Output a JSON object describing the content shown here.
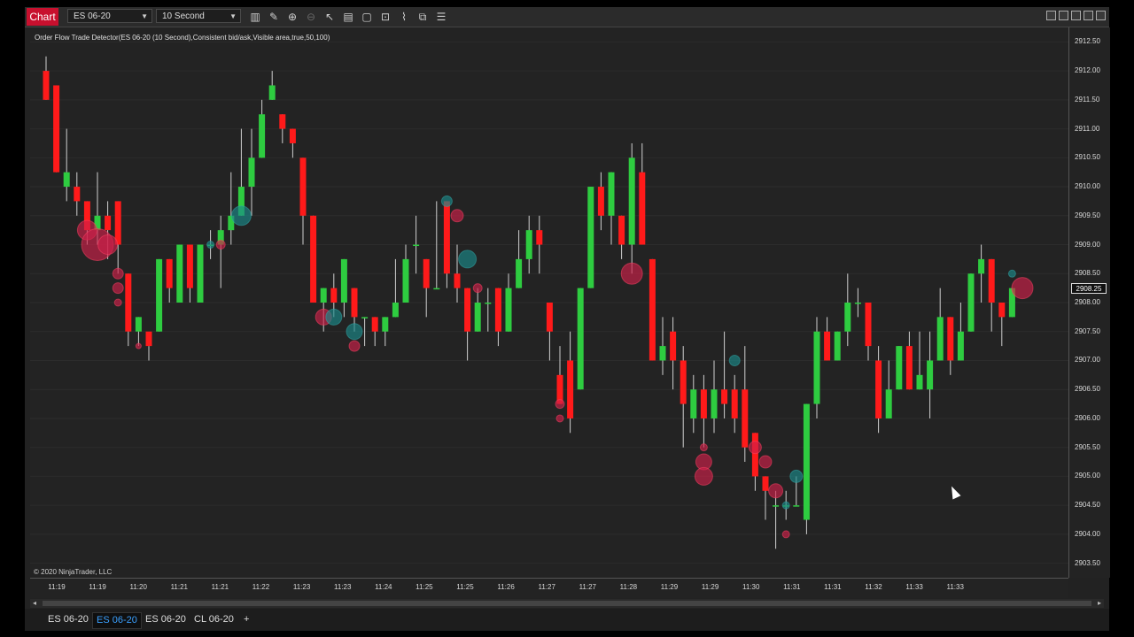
{
  "toolbar": {
    "chart_label": "Chart",
    "instrument": "ES 06-20",
    "interval": "10 Second",
    "icons": [
      "bars-icon",
      "draw-icon",
      "zoom-in-icon",
      "zoom-out-icon",
      "pointer-icon",
      "properties-icon",
      "data-box-icon",
      "snapshot-icon",
      "strategies-icon",
      "indicators-icon",
      "list-icon"
    ]
  },
  "indicator_label": "Order Flow Trade Detector(ES 06-20 (10 Second),Consistent bid/ask,Visible area,true,50,100)",
  "copyright": "© 2020 NinjaTrader, LLC",
  "price_axis": [
    "2912.50",
    "2912.00",
    "2911.50",
    "2911.00",
    "2910.50",
    "2910.00",
    "2909.50",
    "2909.00",
    "2908.50",
    "2908.00",
    "2907.50",
    "2907.00",
    "2906.50",
    "2906.00",
    "2905.50",
    "2905.00",
    "2904.50",
    "2904.00",
    "2903.50"
  ],
  "current_price": "2908.25",
  "time_axis": [
    "11:19",
    "11:19",
    "11:20",
    "11:21",
    "11:21",
    "11:22",
    "11:23",
    "11:23",
    "11:24",
    "11:25",
    "11:25",
    "11:26",
    "11:27",
    "11:27",
    "11:28",
    "11:29",
    "11:29",
    "11:30",
    "11:31",
    "11:31",
    "11:32",
    "11:33",
    "11:33"
  ],
  "tabs": [
    "ES 06-20",
    "ES 06-20",
    "ES 06-20",
    "CL 06-20"
  ],
  "add_tab": "+",
  "colors": {
    "up": "#2ecc40",
    "down": "#ff1a1a",
    "bubble_sell": "#d0204a",
    "bubble_buy": "#1a8a8a",
    "background": "#232323"
  },
  "chart_data": {
    "type": "candlestick",
    "y_range": [
      2903.25,
      2912.75
    ],
    "candles": [
      [
        2912.0,
        2911.5,
        2912.25,
        2911.5
      ],
      [
        2911.75,
        2910.25,
        2911.75,
        2910.25
      ],
      [
        2910.0,
        2910.25,
        2911.0,
        2909.75
      ],
      [
        2910.0,
        2909.75,
        2910.25,
        2909.5
      ],
      [
        2909.75,
        2909.25,
        2909.75,
        2909.0
      ],
      [
        2909.25,
        2909.5,
        2910.25,
        2909.0
      ],
      [
        2909.5,
        2909.25,
        2909.75,
        2908.75
      ],
      [
        2909.75,
        2909.0,
        2909.75,
        2908.5
      ],
      [
        2908.5,
        2907.5,
        2908.5,
        2907.25
      ],
      [
        2907.5,
        2907.75,
        2907.75,
        2907.25
      ],
      [
        2907.5,
        2907.25,
        2907.25,
        2907.0
      ],
      [
        2907.5,
        2908.75,
        2908.75,
        2907.5
      ],
      [
        2908.75,
        2908.25,
        2908.75,
        2908.0
      ],
      [
        2908.0,
        2909.0,
        2909.0,
        2908.0
      ],
      [
        2909.0,
        2908.25,
        2909.0,
        2908.0
      ],
      [
        2908.0,
        2909.0,
        2909.0,
        2908.0
      ],
      [
        2909.0,
        2909.0,
        2909.25,
        2908.75
      ],
      [
        2909.0,
        2909.25,
        2909.5,
        2908.25
      ],
      [
        2909.25,
        2909.5,
        2910.25,
        2909.0
      ],
      [
        2909.5,
        2910.0,
        2911.0,
        2909.5
      ],
      [
        2910.0,
        2910.5,
        2911.0,
        2909.5
      ],
      [
        2910.5,
        2911.25,
        2911.5,
        2910.5
      ],
      [
        2911.5,
        2911.75,
        2912.0,
        2911.5
      ],
      [
        2911.25,
        2911.0,
        2911.25,
        2910.75
      ],
      [
        2911.0,
        2910.75,
        2911.0,
        2910.5
      ],
      [
        2910.5,
        2909.5,
        2910.5,
        2909.0
      ],
      [
        2909.5,
        2908.0,
        2909.5,
        2908.0
      ],
      [
        2908.0,
        2908.25,
        2908.25,
        2907.5
      ],
      [
        2908.25,
        2908.0,
        2908.5,
        2907.75
      ],
      [
        2908.0,
        2908.75,
        2908.75,
        2907.75
      ],
      [
        2908.25,
        2907.75,
        2908.25,
        2907.5
      ],
      [
        2907.75,
        2907.75,
        2907.75,
        2907.25
      ],
      [
        2907.75,
        2907.5,
        2907.75,
        2907.25
      ],
      [
        2907.5,
        2907.75,
        2907.75,
        2907.25
      ],
      [
        2907.75,
        2908.0,
        2908.75,
        2907.75
      ],
      [
        2908.0,
        2908.75,
        2909.0,
        2908.0
      ],
      [
        2909.0,
        2909.0,
        2909.5,
        2908.5
      ],
      [
        2908.75,
        2908.25,
        2908.75,
        2907.75
      ],
      [
        2908.25,
        2908.25,
        2909.75,
        2908.25
      ],
      [
        2909.75,
        2908.5,
        2909.75,
        2908.25
      ],
      [
        2908.5,
        2908.25,
        2909.0,
        2908.0
      ],
      [
        2908.25,
        2907.5,
        2908.25,
        2907.0
      ],
      [
        2907.5,
        2908.0,
        2908.25,
        2907.5
      ],
      [
        2908.0,
        2908.0,
        2908.25,
        2907.5
      ],
      [
        2908.25,
        2907.5,
        2908.25,
        2907.25
      ],
      [
        2907.5,
        2908.25,
        2908.5,
        2907.5
      ],
      [
        2908.25,
        2908.75,
        2909.25,
        2908.25
      ],
      [
        2908.75,
        2909.25,
        2909.5,
        2908.5
      ],
      [
        2909.25,
        2909.0,
        2909.5,
        2908.5
      ],
      [
        2908.0,
        2907.5,
        2908.0,
        2907.0
      ],
      [
        2906.75,
        2906.25,
        2907.25,
        2906.25
      ],
      [
        2907.0,
        2906.0,
        2907.5,
        2905.75
      ],
      [
        2906.5,
        2908.25,
        2908.25,
        2906.5
      ],
      [
        2908.25,
        2910.0,
        2910.0,
        2908.25
      ],
      [
        2910.0,
        2909.5,
        2910.25,
        2909.25
      ],
      [
        2909.5,
        2910.25,
        2910.25,
        2909.0
      ],
      [
        2909.5,
        2909.0,
        2909.5,
        2908.75
      ],
      [
        2909.0,
        2910.5,
        2910.75,
        2908.5
      ],
      [
        2910.25,
        2909.0,
        2910.75,
        2909.0
      ],
      [
        2908.75,
        2907.0,
        2908.75,
        2907.0
      ],
      [
        2907.0,
        2907.25,
        2907.75,
        2906.75
      ],
      [
        2907.5,
        2907.0,
        2907.75,
        2906.5
      ],
      [
        2907.0,
        2906.25,
        2907.25,
        2905.5
      ],
      [
        2906.0,
        2906.5,
        2906.75,
        2905.75
      ],
      [
        2906.5,
        2906.0,
        2906.75,
        2905.5
      ],
      [
        2906.0,
        2906.5,
        2907.0,
        2905.75
      ],
      [
        2906.5,
        2906.25,
        2907.5,
        2906.0
      ],
      [
        2906.5,
        2906.0,
        2906.75,
        2905.75
      ],
      [
        2906.5,
        2905.5,
        2907.25,
        2905.25
      ],
      [
        2905.75,
        2905.0,
        2905.75,
        2904.75
      ],
      [
        2905.0,
        2904.75,
        2905.0,
        2904.25
      ],
      [
        2904.5,
        2904.5,
        2904.75,
        2903.75
      ],
      [
        2904.5,
        2904.5,
        2904.75,
        2904.25
      ],
      [
        2904.5,
        2904.5,
        2905.0,
        2904.5
      ],
      [
        2904.25,
        2906.25,
        2906.25,
        2904.0
      ],
      [
        2906.25,
        2907.5,
        2907.75,
        2906.0
      ],
      [
        2907.5,
        2907.0,
        2907.75,
        2907.0
      ],
      [
        2907.0,
        2907.5,
        2907.5,
        2907.0
      ],
      [
        2907.5,
        2908.0,
        2908.5,
        2907.25
      ],
      [
        2908.0,
        2908.0,
        2908.25,
        2907.75
      ],
      [
        2908.0,
        2907.25,
        2908.0,
        2907.0
      ],
      [
        2907.0,
        2906.0,
        2907.25,
        2905.75
      ],
      [
        2906.0,
        2906.5,
        2907.0,
        2906.0
      ],
      [
        2906.5,
        2907.25,
        2907.25,
        2906.5
      ],
      [
        2907.25,
        2906.5,
        2907.5,
        2906.5
      ],
      [
        2906.5,
        2906.75,
        2907.5,
        2906.5
      ],
      [
        2906.5,
        2907.0,
        2907.5,
        2906.0
      ],
      [
        2907.0,
        2907.75,
        2908.25,
        2907.0
      ],
      [
        2907.75,
        2907.0,
        2907.75,
        2906.75
      ],
      [
        2907.0,
        2907.5,
        2908.0,
        2907.0
      ],
      [
        2907.5,
        2908.5,
        2908.5,
        2907.5
      ],
      [
        2908.5,
        2908.75,
        2909.0,
        2908.0
      ],
      [
        2908.75,
        2908.0,
        2908.75,
        2907.5
      ],
      [
        2908.0,
        2907.75,
        2908.0,
        2907.25
      ],
      [
        2907.75,
        2908.25,
        2908.25,
        2907.75
      ]
    ],
    "bubbles": [
      [
        4,
        2909.25,
        "sell",
        11
      ],
      [
        5,
        2909.0,
        "sell",
        18
      ],
      [
        6,
        2909.0,
        "sell",
        11
      ],
      [
        7,
        2908.5,
        "sell",
        6
      ],
      [
        7,
        2908.25,
        "sell",
        6
      ],
      [
        7,
        2908.0,
        "sell",
        4
      ],
      [
        9,
        2907.25,
        "sell",
        3
      ],
      [
        16,
        2909.0,
        "buy",
        4
      ],
      [
        17,
        2909.0,
        "sell",
        5
      ],
      [
        19,
        2909.5,
        "buy",
        11
      ],
      [
        27,
        2907.75,
        "sell",
        9
      ],
      [
        28,
        2907.75,
        "buy",
        9
      ],
      [
        30,
        2907.5,
        "buy",
        9
      ],
      [
        30,
        2907.25,
        "sell",
        6
      ],
      [
        39,
        2909.75,
        "buy",
        6
      ],
      [
        40,
        2909.5,
        "sell",
        7
      ],
      [
        41,
        2908.75,
        "buy",
        10
      ],
      [
        42,
        2908.25,
        "sell",
        5
      ],
      [
        50,
        2906.25,
        "sell",
        5
      ],
      [
        50,
        2906.0,
        "sell",
        4
      ],
      [
        57,
        2908.5,
        "sell",
        12
      ],
      [
        64,
        2905.5,
        "sell",
        4
      ],
      [
        64,
        2905.25,
        "sell",
        9
      ],
      [
        64,
        2905.0,
        "sell",
        10
      ],
      [
        67,
        2907.0,
        "buy",
        6
      ],
      [
        69,
        2905.5,
        "sell",
        7
      ],
      [
        70,
        2905.25,
        "sell",
        7
      ],
      [
        71,
        2904.75,
        "sell",
        8
      ],
      [
        72,
        2904.5,
        "buy",
        4
      ],
      [
        73,
        2905.0,
        "buy",
        7
      ],
      [
        72,
        2904.0,
        "sell",
        4
      ],
      [
        94,
        2908.5,
        "buy",
        4
      ],
      [
        95,
        2908.25,
        "sell",
        12
      ]
    ]
  }
}
